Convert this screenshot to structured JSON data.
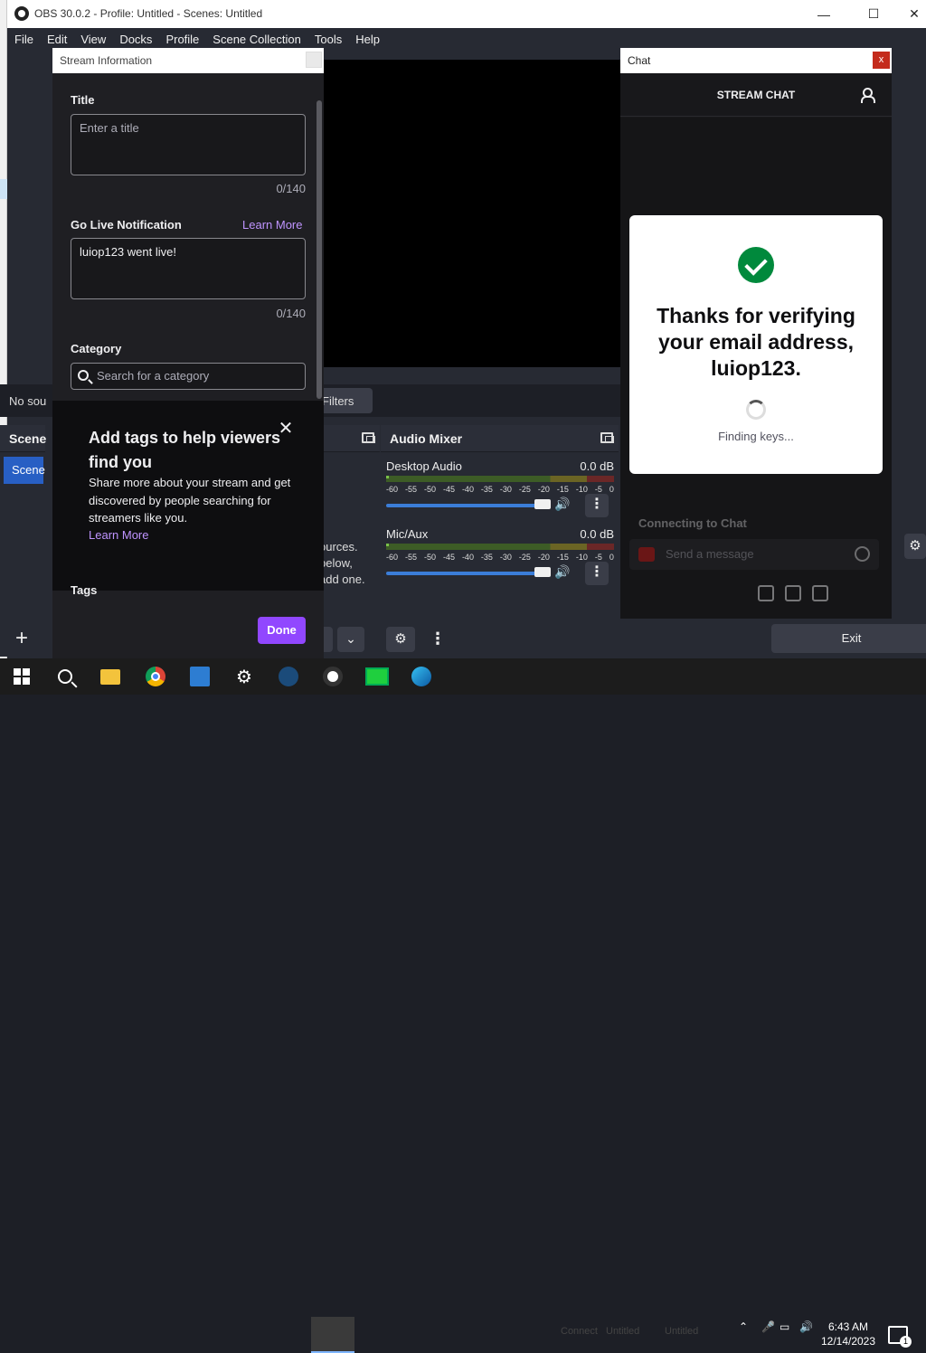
{
  "window": {
    "title": "OBS 30.0.2 - Profile: Untitled - Scenes: Untitled",
    "minimize": "—",
    "maximize": "☐",
    "close": "✕"
  },
  "menu": [
    "File",
    "Edit",
    "View",
    "Docks",
    "Profile",
    "Scene Collection",
    "Tools",
    "Help"
  ],
  "source_bar": {
    "no_source": "No sou",
    "filters": "Filters"
  },
  "scenes": {
    "header": "Scene",
    "item": "Scene",
    "add": "+"
  },
  "sources": {
    "hint_lines": [
      "ources.",
      "pelow,",
      "add one."
    ],
    "chevron": "⌄"
  },
  "audio_mixer": {
    "header": "Audio Mixer",
    "ticks": [
      "-60",
      "-55",
      "-50",
      "-45",
      "-40",
      "-35",
      "-30",
      "-25",
      "-20",
      "-15",
      "-10",
      "-5",
      "0"
    ],
    "channels": [
      {
        "name": "Desktop Audio",
        "db": "0.0 dB",
        "volume": 1.0
      },
      {
        "name": "Mic/Aux",
        "db": "0.0 dB",
        "volume": 1.0
      }
    ],
    "vol_icon": "🔊",
    "kebab": "⋮",
    "gear": "⚙",
    "dots": "⋮"
  },
  "right_panel": {
    "exit": "Exit",
    "gear": "⚙"
  },
  "stream_info": {
    "window_title": "Stream Information",
    "title_label": "Title",
    "title_placeholder": "Enter a title",
    "title_counter": "0/140",
    "notif_label": "Go Live Notification",
    "notif_learn_more": "Learn More",
    "notif_value": "luiop123 went live!",
    "notif_counter": "0/140",
    "category_label": "Category",
    "category_placeholder": "Search for a category",
    "promo_title": "Add tags to help viewers find you",
    "promo_text": "Share more about your stream and get discovered by people searching for streamers like you.",
    "promo_learn_more": "Learn More",
    "promo_close": "✕",
    "tags_label": "Tags",
    "done": "Done"
  },
  "chat": {
    "window_title": "Chat",
    "close": "x",
    "header": "STREAM CHAT",
    "verify_message": "Thanks for verifying your email address, luiop123.",
    "status": "Finding keys...",
    "connecting": "Connecting to Chat",
    "send_placeholder": "Send a message"
  },
  "taskbar": {
    "time": "6:43 AM",
    "date": "12/14/2023",
    "faded_items": [
      "Connect",
      "Untitled",
      "Untitled"
    ]
  }
}
